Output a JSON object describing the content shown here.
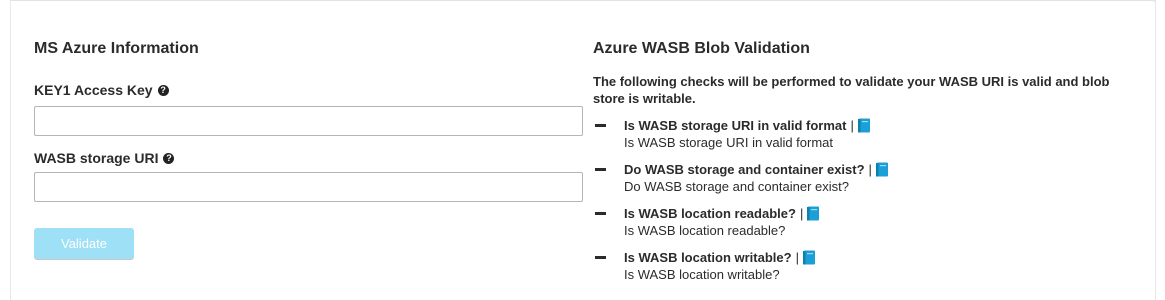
{
  "left_panel": {
    "title": "MS Azure Information",
    "key1": {
      "label": "KEY1 Access Key",
      "value": "",
      "placeholder": ""
    },
    "wasb_uri": {
      "label": "WASB storage URI",
      "value": "",
      "placeholder": ""
    },
    "validate_label": "Validate"
  },
  "right_panel": {
    "title": "Azure WASB Blob Validation",
    "intro": "The following checks will be performed to validate your WASB URI is valid and blob store is writable.",
    "separator": "|",
    "checks": [
      {
        "title": "Is WASB storage URI in valid format",
        "description": "Is WASB storage URI in valid format",
        "status_icon": "dash-icon",
        "link_icon": "book-icon"
      },
      {
        "title": "Do WASB storage and container exist?",
        "description": "Do WASB storage and container exist?",
        "status_icon": "dash-icon",
        "link_icon": "book-icon"
      },
      {
        "title": "Is WASB location readable?",
        "description": "Is WASB location readable?",
        "status_icon": "dash-icon",
        "link_icon": "book-icon"
      },
      {
        "title": "Is WASB location writable?",
        "description": "Is WASB location writable?",
        "status_icon": "dash-icon",
        "link_icon": "book-icon"
      }
    ]
  },
  "colors": {
    "text": "#2b2b2b",
    "button_disabled": "#9ee0f5",
    "book_icon": "#1aa0d6",
    "input_border": "#b5b5b5"
  }
}
